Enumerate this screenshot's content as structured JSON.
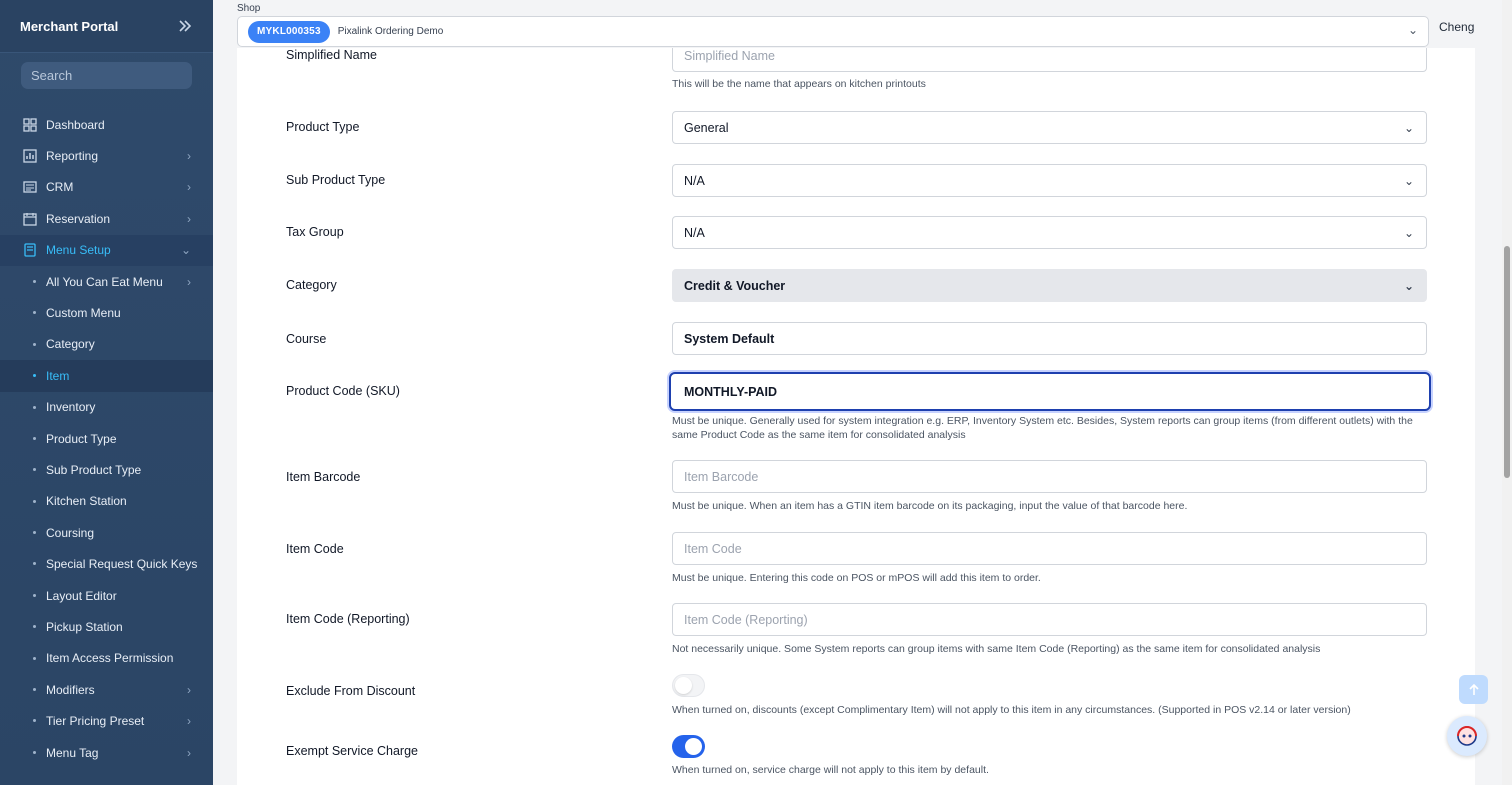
{
  "sidebar": {
    "title": "Merchant Portal",
    "search_placeholder": "Search",
    "nav": [
      {
        "label": "Dashboard",
        "icon": "dashboard-icon",
        "has_children": false
      },
      {
        "label": "Reporting",
        "icon": "chart-icon",
        "has_children": true
      },
      {
        "label": "CRM",
        "icon": "crm-icon",
        "has_children": true
      },
      {
        "label": "Reservation",
        "icon": "calendar-icon",
        "has_children": true
      },
      {
        "label": "Menu Setup",
        "icon": "book-icon",
        "has_children": true,
        "open": true
      }
    ],
    "sub_items": [
      {
        "label": "All You Can Eat Menu",
        "has_children": true
      },
      {
        "label": "Custom Menu"
      },
      {
        "label": "Category"
      },
      {
        "label": "Item",
        "active": true
      },
      {
        "label": "Inventory"
      },
      {
        "label": "Product Type"
      },
      {
        "label": "Sub Product Type"
      },
      {
        "label": "Kitchen Station"
      },
      {
        "label": "Coursing"
      },
      {
        "label": "Special Request Quick Keys"
      },
      {
        "label": "Layout Editor"
      },
      {
        "label": "Pickup Station"
      },
      {
        "label": "Item Access Permission"
      },
      {
        "label": "Modifiers",
        "has_children": true
      },
      {
        "label": "Tier Pricing Preset",
        "has_children": true
      },
      {
        "label": "Menu Tag",
        "has_children": true
      }
    ]
  },
  "topbar": {
    "shop_label": "Shop",
    "shop_code": "MYKL000353",
    "shop_name": "Pixalink Ordering Demo",
    "user": "Cheng"
  },
  "form": {
    "simplified_name": {
      "label": "Simplified Name",
      "placeholder": "Simplified Name",
      "help": "This will be the name that appears on kitchen printouts"
    },
    "product_type": {
      "label": "Product Type",
      "value": "General"
    },
    "sub_product_type": {
      "label": "Sub Product Type",
      "value": "N/A"
    },
    "tax_group": {
      "label": "Tax Group",
      "value": "N/A"
    },
    "category": {
      "label": "Category",
      "value": "Credit & Voucher"
    },
    "course": {
      "label": "Course",
      "value": "System Default"
    },
    "sku": {
      "label": "Product Code (SKU)",
      "value": "MONTHLY-PAID",
      "help": "Must be unique. Generally used for system integration e.g. ERP, Inventory System etc. Besides, System reports can group items (from different outlets) with the same Product Code as the same item for consolidated analysis"
    },
    "barcode": {
      "label": "Item Barcode",
      "placeholder": "Item Barcode",
      "help": "Must be unique. When an item has a GTIN item barcode on its packaging, input the value of that barcode here."
    },
    "item_code": {
      "label": "Item Code",
      "placeholder": "Item Code",
      "help": "Must be unique. Entering this code on POS or mPOS will add this item to order."
    },
    "item_code_reporting": {
      "label": "Item Code (Reporting)",
      "placeholder": "Item Code (Reporting)",
      "help": "Not necessarily unique. Some System reports can group items with same Item Code (Reporting) as the same item for consolidated analysis"
    },
    "exclude_discount": {
      "label": "Exclude From Discount",
      "on": false,
      "help": "When turned on, discounts (except Complimentary Item) will not apply to this item in any circumstances. (Supported in POS v2.14 or later version)"
    },
    "exempt_service": {
      "label": "Exempt Service Charge",
      "on": true,
      "help": "When turned on, service charge will not apply to this item by default."
    }
  },
  "colors": {
    "accent": "#3b82f6",
    "sidebar_bg": "#2f4a6b",
    "active_text": "#38bdf8",
    "focus_border": "#1e40af"
  }
}
